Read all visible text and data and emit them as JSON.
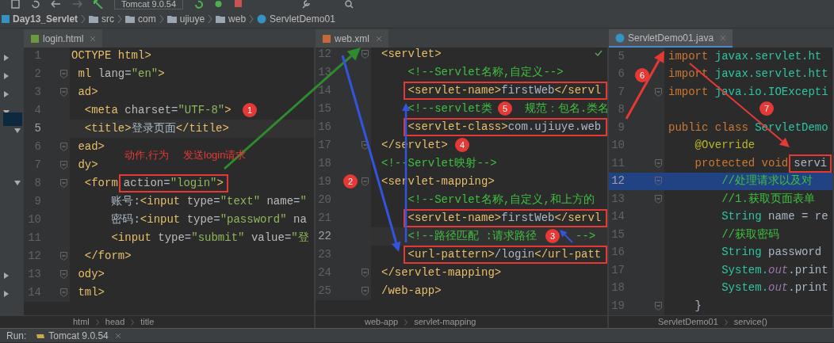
{
  "toolbar": {
    "run_config": "Tomcat 9.0.54"
  },
  "nav_bar": [
    {
      "label": "Day13_Servlet",
      "kind": "project"
    },
    {
      "label": "src",
      "kind": "folder"
    },
    {
      "label": "com",
      "kind": "folder"
    },
    {
      "label": "ujiuye",
      "kind": "folder"
    },
    {
      "label": "web",
      "kind": "folder"
    },
    {
      "label": "ServletDemo01",
      "kind": "class"
    }
  ],
  "panes": [
    {
      "tab": {
        "label": "login.html",
        "selected": false,
        "kind": "html"
      },
      "lines": [
        {
          "number": "1",
          "fold": false,
          "current": false,
          "selected": false,
          "framed": false,
          "segments": [
            {
              "kind": "tag",
              "text": "OCTYPE html>"
            }
          ]
        },
        {
          "number": "2",
          "fold": true,
          "current": false,
          "selected": false,
          "framed": false,
          "segments": [
            {
              "kind": "tag",
              "text": " ml "
            },
            {
              "kind": "attr",
              "text": "lang"
            },
            {
              "kind": "plain",
              "text": "="
            },
            {
              "kind": "string",
              "text": "\"en\""
            },
            {
              "kind": "tag",
              "text": ">"
            }
          ]
        },
        {
          "number": "3",
          "fold": true,
          "current": false,
          "selected": false,
          "framed": false,
          "segments": [
            {
              "kind": "tag",
              "text": " ad>"
            }
          ]
        },
        {
          "number": "4",
          "fold": false,
          "current": false,
          "selected": false,
          "framed": false,
          "segments": [
            {
              "kind": "tag",
              "text": "  <meta "
            },
            {
              "kind": "attr",
              "text": "charset"
            },
            {
              "kind": "plain",
              "text": "="
            },
            {
              "kind": "string",
              "text": "\"UTF-8\""
            },
            {
              "kind": "tag",
              "text": ">"
            }
          ]
        },
        {
          "number": "5",
          "fold": false,
          "current": true,
          "selected": false,
          "framed": false,
          "segments": [
            {
              "kind": "tag",
              "text": "  <title>"
            },
            {
              "kind": "plain",
              "text": "登录页面"
            },
            {
              "kind": "tag",
              "text": "</title>"
            }
          ]
        },
        {
          "number": "6",
          "fold": true,
          "current": false,
          "selected": false,
          "framed": false,
          "segments": [
            {
              "kind": "tag",
              "text": " ead>"
            }
          ]
        },
        {
          "number": "7",
          "fold": true,
          "current": false,
          "selected": false,
          "framed": false,
          "segments": [
            {
              "kind": "tag",
              "text": " dy>"
            }
          ]
        },
        {
          "number": "8",
          "fold": true,
          "current": false,
          "selected": false,
          "framed": true,
          "segments": [
            {
              "kind": "tag",
              "text": "  <form"
            }
          ],
          "segments_after": [
            {
              "kind": "attr",
              "text": "action"
            },
            {
              "kind": "plain",
              "text": "="
            },
            {
              "kind": "string",
              "text": "\"login\""
            },
            {
              "kind": "tag",
              "text": ">"
            }
          ]
        },
        {
          "number": "9",
          "fold": false,
          "current": false,
          "selected": false,
          "framed": false,
          "segments": [
            {
              "kind": "plain",
              "text": "      账号:"
            },
            {
              "kind": "tag",
              "text": "<input "
            },
            {
              "kind": "attr",
              "text": "type"
            },
            {
              "kind": "plain",
              "text": "="
            },
            {
              "kind": "string",
              "text": "\"text\" "
            },
            {
              "kind": "attr",
              "text": "name"
            },
            {
              "kind": "plain",
              "text": "="
            },
            {
              "kind": "string",
              "text": "\""
            }
          ]
        },
        {
          "number": "10",
          "fold": false,
          "current": false,
          "selected": false,
          "framed": false,
          "segments": [
            {
              "kind": "plain",
              "text": "      密码:"
            },
            {
              "kind": "tag",
              "text": "<input "
            },
            {
              "kind": "attr",
              "text": "type"
            },
            {
              "kind": "plain",
              "text": "="
            },
            {
              "kind": "string",
              "text": "\"password\" "
            },
            {
              "kind": "attr",
              "text": "na"
            }
          ]
        },
        {
          "number": "11",
          "fold": false,
          "current": false,
          "selected": false,
          "framed": false,
          "segments": [
            {
              "kind": "tag",
              "text": "      <input "
            },
            {
              "kind": "attr",
              "text": "type"
            },
            {
              "kind": "plain",
              "text": "="
            },
            {
              "kind": "string",
              "text": "\"submit\" "
            },
            {
              "kind": "attr",
              "text": "value"
            },
            {
              "kind": "plain",
              "text": "="
            },
            {
              "kind": "string",
              "text": "\"登"
            }
          ]
        },
        {
          "number": "12",
          "fold": true,
          "current": false,
          "selected": false,
          "framed": false,
          "segments": [
            {
              "kind": "tag",
              "text": "  </form>"
            }
          ]
        },
        {
          "number": "13",
          "fold": true,
          "current": false,
          "selected": false,
          "framed": false,
          "segments": [
            {
              "kind": "tag",
              "text": " ody>"
            }
          ]
        },
        {
          "number": "14",
          "fold": true,
          "current": false,
          "selected": false,
          "framed": false,
          "segments": [
            {
              "kind": "tag",
              "text": " tml>"
            }
          ]
        }
      ],
      "breadcrumb": [
        "html",
        "head",
        "title"
      ]
    },
    {
      "tab": {
        "label": "web.xml",
        "selected": false,
        "kind": "xml"
      },
      "lines": [
        {
          "number": "12",
          "fold": true,
          "current": false,
          "selected": false,
          "framed": false,
          "segments": [
            {
              "kind": "tag",
              "text": "<servlet>"
            }
          ]
        },
        {
          "number": "13",
          "fold": false,
          "current": false,
          "selected": false,
          "framed": false,
          "segments": [
            {
              "kind": "comment",
              "text": "    <!--Servlet名称,自定义-->"
            }
          ]
        },
        {
          "number": "14",
          "fold": false,
          "current": false,
          "selected": false,
          "framed": true,
          "segments": [
            {
              "kind": "tag",
              "text": "    <servlet-name>"
            },
            {
              "kind": "plain",
              "text": "firstWeb"
            },
            {
              "kind": "tag",
              "text": "</servl"
            }
          ]
        },
        {
          "number": "15",
          "fold": false,
          "current": false,
          "selected": false,
          "framed": false,
          "segments": [
            {
              "kind": "comment",
              "text": "    <!--servlet类"
            }
          ],
          "segments_after": [
            {
              "kind": "comment",
              "text": "    规范：包名.类名"
            }
          ]
        },
        {
          "number": "16",
          "fold": false,
          "current": false,
          "selected": false,
          "framed": true,
          "segments": [
            {
              "kind": "tag",
              "text": "    <servlet-class>"
            },
            {
              "kind": "plain",
              "text": "com.ujiuye.web"
            }
          ]
        },
        {
          "number": "17",
          "fold": true,
          "current": false,
          "selected": false,
          "framed": false,
          "segments": [
            {
              "kind": "tag",
              "text": "</servlet>"
            }
          ]
        },
        {
          "number": "18",
          "fold": false,
          "current": false,
          "selected": false,
          "framed": false,
          "segments": [
            {
              "kind": "comment",
              "text": "<!--Servlet映射-->"
            }
          ]
        },
        {
          "number": "19",
          "fold": true,
          "current": false,
          "selected": false,
          "framed": false,
          "segments": [
            {
              "kind": "tag",
              "text": "<servlet-mapping>"
            }
          ]
        },
        {
          "number": "20",
          "fold": false,
          "current": false,
          "selected": false,
          "framed": false,
          "segments": [
            {
              "kind": "comment",
              "text": "    <!--Servlet名称,自定义,和上方的"
            }
          ]
        },
        {
          "number": "21",
          "fold": false,
          "current": false,
          "selected": false,
          "framed": true,
          "segments": [
            {
              "kind": "tag",
              "text": "    <servlet-name>"
            },
            {
              "kind": "plain",
              "text": "firstWeb"
            },
            {
              "kind": "tag",
              "text": "</servl"
            }
          ]
        },
        {
          "number": "22",
          "fold": false,
          "current": true,
          "selected": false,
          "framed": false,
          "segments": [
            {
              "kind": "comment",
              "text": "    <!--路径匹配 :请求路径"
            }
          ],
          "segments_after": [
            {
              "kind": "comment",
              "text": "     -->"
            }
          ]
        },
        {
          "number": "23",
          "fold": false,
          "current": false,
          "selected": false,
          "framed": true,
          "segments": [
            {
              "kind": "tag",
              "text": "    <url-pattern>"
            },
            {
              "kind": "plain",
              "text": "/login"
            },
            {
              "kind": "tag",
              "text": "</url-patt"
            }
          ]
        },
        {
          "number": "24",
          "fold": true,
          "current": false,
          "selected": false,
          "framed": false,
          "segments": [
            {
              "kind": "tag",
              "text": "</servlet-mapping>"
            }
          ]
        },
        {
          "number": "25",
          "fold": true,
          "current": false,
          "selected": false,
          "framed": false,
          "segments": [
            {
              "kind": "tag",
              "text": "/web-app>"
            }
          ]
        }
      ],
      "breadcrumb": [
        "web-app",
        "servlet-mapping"
      ]
    },
    {
      "tab": {
        "label": "ServletDemo01.java",
        "selected": true,
        "kind": "java"
      },
      "lines": [
        {
          "number": "5",
          "fold": false,
          "current": false,
          "selected": false,
          "framed": false,
          "segments": [
            {
              "kind": "keyword",
              "text": "import "
            },
            {
              "kind": "type",
              "text": "javax.servlet.ht"
            }
          ]
        },
        {
          "number": "6",
          "fold": false,
          "current": false,
          "selected": false,
          "framed": false,
          "segments": [
            {
              "kind": "keyword",
              "text": "import "
            },
            {
              "kind": "type",
              "text": "javax.servlet.htt"
            }
          ]
        },
        {
          "number": "7",
          "fold": true,
          "current": false,
          "selected": false,
          "framed": false,
          "segments": [
            {
              "kind": "keyword",
              "text": "import "
            },
            {
              "kind": "type",
              "text": "java.io.IOExcepti"
            }
          ]
        },
        {
          "number": "8",
          "fold": false,
          "current": false,
          "selected": false,
          "framed": false
        },
        {
          "number": "9",
          "fold": false,
          "current": false,
          "selected": false,
          "framed": false,
          "segments": [
            {
              "kind": "keyword",
              "text": "public class "
            },
            {
              "kind": "type",
              "text": "ServletDemo"
            }
          ]
        },
        {
          "number": "10",
          "fold": false,
          "current": false,
          "selected": false,
          "framed": false,
          "segments": [
            {
              "kind": "annotation",
              "text": "    @Override"
            }
          ]
        },
        {
          "number": "11",
          "fold": true,
          "current": false,
          "selected": false,
          "framed": true,
          "segments": [
            {
              "kind": "keyword",
              "text": "    protected void"
            }
          ],
          "segments_after": [
            {
              "kind": "plain",
              "text": "servi"
            }
          ]
        },
        {
          "number": "12",
          "fold": true,
          "current": false,
          "selected": true,
          "framed": false,
          "segments": [
            {
              "kind": "comment",
              "text": "        //处理请求以及对"
            }
          ]
        },
        {
          "number": "13",
          "fold": true,
          "current": false,
          "selected": false,
          "framed": false,
          "segments": [
            {
              "kind": "comment",
              "text": "        //1.获取页面表单"
            }
          ]
        },
        {
          "number": "14",
          "fold": false,
          "current": false,
          "selected": false,
          "framed": false,
          "segments": [
            {
              "kind": "type",
              "text": "        String "
            },
            {
              "kind": "plain",
              "text": "name = re"
            }
          ]
        },
        {
          "number": "15",
          "fold": false,
          "current": false,
          "selected": false,
          "framed": false,
          "segments": [
            {
              "kind": "comment",
              "text": "        //获取密码"
            }
          ]
        },
        {
          "number": "16",
          "fold": false,
          "current": false,
          "selected": false,
          "framed": false,
          "segments": [
            {
              "kind": "type",
              "text": "        String "
            },
            {
              "kind": "plain",
              "text": "password"
            }
          ]
        },
        {
          "number": "17",
          "fold": false,
          "current": false,
          "selected": false,
          "framed": false,
          "segments": [
            {
              "kind": "type",
              "text": "        System."
            },
            {
              "kind": "field",
              "text": "out"
            },
            {
              "kind": "plain",
              "text": ".print"
            }
          ]
        },
        {
          "number": "18",
          "fold": false,
          "current": false,
          "selected": false,
          "framed": false,
          "segments": [
            {
              "kind": "type",
              "text": "        System."
            },
            {
              "kind": "field",
              "text": "out"
            },
            {
              "kind": "plain",
              "text": ".print"
            }
          ]
        },
        {
          "number": "19",
          "fold": true,
          "current": false,
          "selected": false,
          "framed": false,
          "segments": [
            {
              "kind": "plain",
              "text": "    }"
            }
          ]
        }
      ],
      "breadcrumb": [
        "ServletDemo01",
        "service()"
      ]
    }
  ],
  "annotations": {
    "badges": [
      "1",
      "2",
      "3",
      "4",
      "5",
      "6",
      "7"
    ],
    "notes": [
      "动作,行为",
      "发送login请求"
    ]
  },
  "run_bar": {
    "label": "Run:",
    "config": "Tomcat 9.0.54"
  }
}
